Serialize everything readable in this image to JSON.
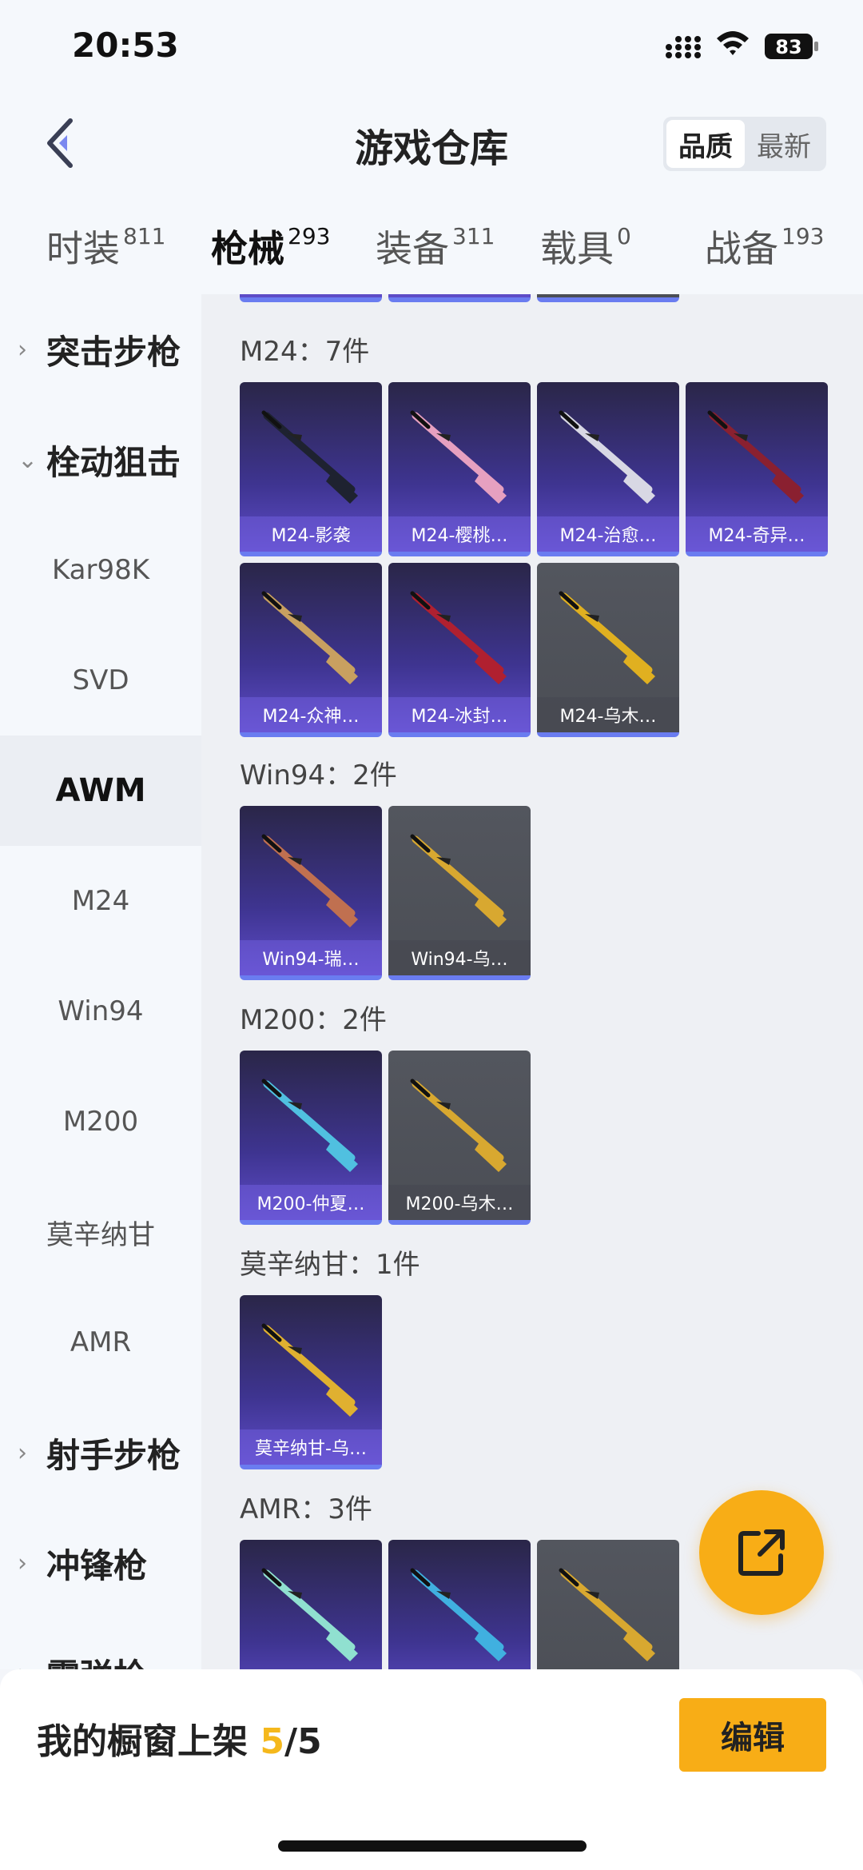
{
  "status_bar": {
    "time": "20:53",
    "battery": "83"
  },
  "header": {
    "title": "游戏仓库",
    "sort_options": [
      "品质",
      "最新"
    ],
    "sort_selected": "品质"
  },
  "tabs": [
    {
      "label": "时装",
      "count": "811"
    },
    {
      "label": "枪械",
      "count": "293"
    },
    {
      "label": "装备",
      "count": "311"
    },
    {
      "label": "载具",
      "count": "0"
    },
    {
      "label": "战备",
      "count": "193"
    }
  ],
  "sidebar": {
    "items": [
      {
        "label": "突击步枪",
        "type": "group",
        "expanded": false
      },
      {
        "label": "栓动狙击",
        "type": "group",
        "expanded": true
      },
      {
        "label": "Kar98K",
        "type": "item"
      },
      {
        "label": "SVD",
        "type": "item"
      },
      {
        "label": "AWM",
        "type": "item",
        "selected": true
      },
      {
        "label": "M24",
        "type": "item"
      },
      {
        "label": "Win94",
        "type": "item"
      },
      {
        "label": "M200",
        "type": "item"
      },
      {
        "label": "莫辛纳甘",
        "type": "item"
      },
      {
        "label": "AMR",
        "type": "item"
      },
      {
        "label": "射手步枪",
        "type": "group",
        "expanded": false
      },
      {
        "label": "冲锋枪",
        "type": "group",
        "expanded": false
      },
      {
        "label": "霰弹枪",
        "type": "group",
        "expanded": false
      }
    ]
  },
  "sections": [
    {
      "title": "M24：7件",
      "items": [
        {
          "name": "M24-影袭",
          "quality": "purple"
        },
        {
          "name": "M24-樱桃…",
          "quality": "purple"
        },
        {
          "name": "M24-治愈…",
          "quality": "purple"
        },
        {
          "name": "M24-奇异…",
          "quality": "purple"
        },
        {
          "name": "M24-众神…",
          "quality": "purple"
        },
        {
          "name": "M24-冰封…",
          "quality": "purple"
        },
        {
          "name": "M24-乌木…",
          "quality": "gray"
        }
      ]
    },
    {
      "title": "Win94：2件",
      "items": [
        {
          "name": "Win94-瑞…",
          "quality": "purple"
        },
        {
          "name": "Win94-乌…",
          "quality": "gray"
        }
      ]
    },
    {
      "title": "M200：2件",
      "items": [
        {
          "name": "M200-仲夏…",
          "quality": "purple"
        },
        {
          "name": "M200-乌木…",
          "quality": "gray"
        }
      ]
    },
    {
      "title": "莫辛纳甘：1件",
      "items": [
        {
          "name": "莫辛纳甘-乌…",
          "quality": "purple"
        }
      ]
    },
    {
      "title": "AMR：3件",
      "items": [
        {
          "name": "",
          "quality": "purple"
        },
        {
          "name": "",
          "quality": "purple"
        },
        {
          "name": "",
          "quality": "gray"
        }
      ]
    }
  ],
  "footer": {
    "showcase_label": "我的橱窗上架",
    "showcase_count": "5",
    "showcase_total": "/5",
    "edit_label": "编辑"
  },
  "colors": {
    "accent": "#f8ad16",
    "tab_indicator": "#f5b81c",
    "purple_card": "#3e3490",
    "gray_card": "#4b4e55"
  }
}
